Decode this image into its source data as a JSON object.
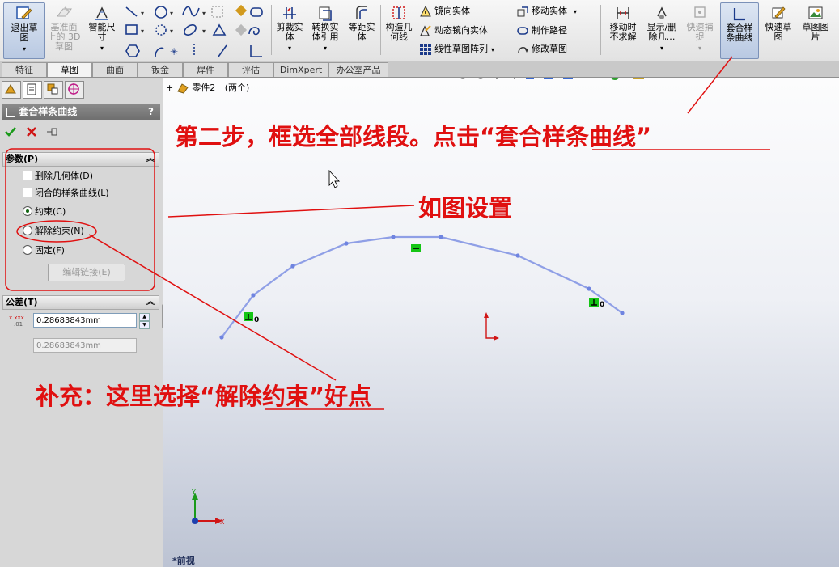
{
  "toolbar": {
    "exit_sketch": [
      "退出草",
      "图"
    ],
    "ref_plane_3d": [
      "基准面",
      "上的 3D",
      "草图"
    ],
    "smart_dim": [
      "智能尺",
      "寸"
    ],
    "trim": [
      "剪裁实",
      "体"
    ],
    "convert": [
      "转换实",
      "体引用"
    ],
    "offset": [
      "等距实",
      "体"
    ],
    "construction": [
      "构造几",
      "何线"
    ],
    "mirror": "镜向实体",
    "dynamic_mirror": "动态镜向实体",
    "linear_pattern": "线性草图阵列",
    "move": "移动实体",
    "make_path": "制作路径",
    "modify_sketch": "修改草图",
    "no_solve_move": [
      "移动时",
      "不求解"
    ],
    "show_delete": [
      "显示/删",
      "除几…"
    ],
    "quick_snap": [
      "快速捕",
      "捉"
    ],
    "fit_spline": [
      "套合样",
      "条曲线"
    ],
    "rapid_sketch": [
      "快速草",
      "图"
    ],
    "sketch_picture": [
      "草图图",
      "片"
    ]
  },
  "tabs": [
    "特征",
    "草图",
    "曲面",
    "钣金",
    "焊件",
    "评估",
    "DimXpert",
    "办公室产品"
  ],
  "active_tab": "草图",
  "tree_path": {
    "part": "零件2",
    "configs": "(两个)"
  },
  "panel": {
    "title": "套合样条曲线",
    "help": "?",
    "params_header": "参数(P)",
    "delete_geometry": "删除几何体(D)",
    "closed_spline": "闭合的样条曲线(L)",
    "constrained": "约束(C)",
    "unconstrained": "解除约束(N)",
    "fix": "固定(F)",
    "edit_link": "编辑链接(E)",
    "tolerance_header": "公差(T)",
    "tolerance_value": "0.28683843mm",
    "tolerance_value2": "0.28683843mm",
    "selected_option": "约束(C)"
  },
  "view": {
    "view_name": "*前视",
    "triad_x": "X",
    "triad_y": "Y",
    "relation_label_left": "0",
    "relation_label_right": "0"
  },
  "annotations": {
    "step2": "第二步，框选全部线段。点击“套合样条曲线”",
    "settings": "如图设置",
    "note": "补充：这里选择“解除约束”好点"
  },
  "colors": {
    "annotation": "#e01010",
    "spline": "#8f9fe6",
    "relation_badge": "#15c515",
    "origin": "#d01515"
  }
}
